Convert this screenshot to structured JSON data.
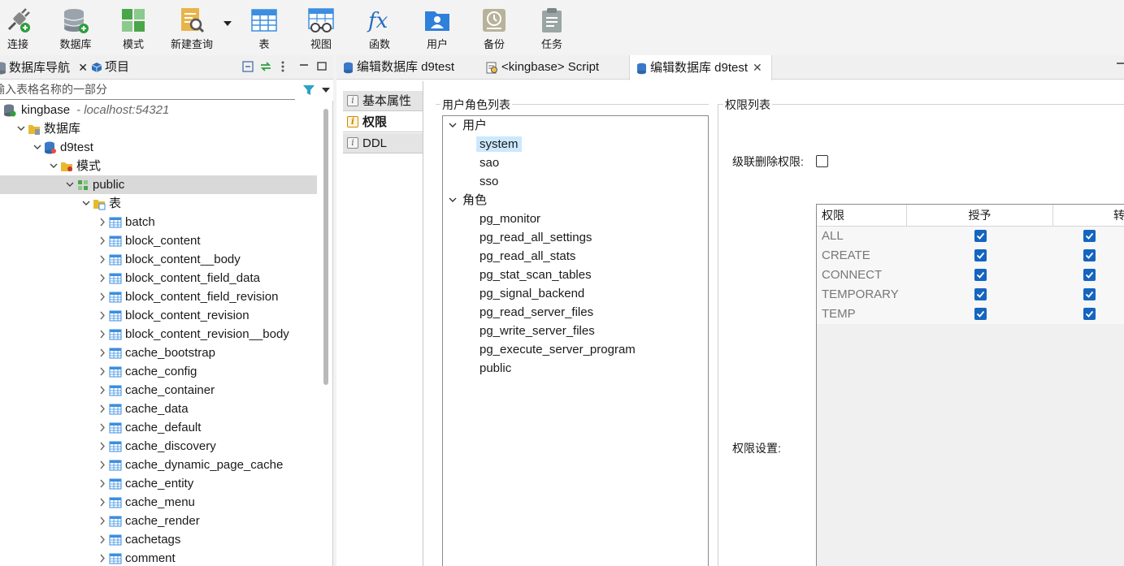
{
  "toolbar": {
    "items": [
      {
        "label": "连接",
        "icon": "connect-plug-icon"
      },
      {
        "label": "数据库",
        "icon": "database-add-icon"
      },
      {
        "label": "模式",
        "icon": "schema-grid-icon"
      },
      {
        "label": "新建查询",
        "icon": "new-query-icon"
      },
      {
        "label": "表",
        "icon": "table-icon"
      },
      {
        "label": "视图",
        "icon": "view-glasses-icon"
      },
      {
        "label": "函数",
        "icon": "function-fx-icon"
      },
      {
        "label": "用户",
        "icon": "user-icon"
      },
      {
        "label": "备份",
        "icon": "backup-clock-icon"
      },
      {
        "label": "任务",
        "icon": "task-clipboard-icon"
      }
    ]
  },
  "navigator": {
    "tab_db_nav": "数据库导航",
    "tab_project": "项目",
    "filter_placeholder": "输入表格名称的一部分",
    "connection": {
      "name": "kingbase",
      "host": "- localhost:54321"
    },
    "databases_label": "数据库",
    "database": "d9test",
    "schemas_label": "模式",
    "schema": "public",
    "tables_label": "表",
    "tables": [
      "batch",
      "block_content",
      "block_content__body",
      "block_content_field_data",
      "block_content_field_revision",
      "block_content_revision",
      "block_content_revision__body",
      "cache_bootstrap",
      "cache_config",
      "cache_container",
      "cache_data",
      "cache_default",
      "cache_discovery",
      "cache_dynamic_page_cache",
      "cache_entity",
      "cache_menu",
      "cache_render",
      "cachetags",
      "comment"
    ]
  },
  "editor": {
    "tabs": [
      {
        "label": "编辑数据库 d9test",
        "active": false
      },
      {
        "label": "<kingbase> Script",
        "active": false
      },
      {
        "label": "编辑数据库 d9test",
        "active": true,
        "closable": true
      }
    ],
    "side_tabs": [
      "基本属性",
      "权限",
      "DDL"
    ],
    "active_side_tab": "权限",
    "role_list_title": "用户角色列表",
    "users_group": "用户",
    "users": [
      "system",
      "sao",
      "sso"
    ],
    "selected_user": "system",
    "roles_group": "角色",
    "roles": [
      "pg_monitor",
      "pg_read_all_settings",
      "pg_read_all_stats",
      "pg_stat_scan_tables",
      "pg_signal_backend",
      "pg_read_server_files",
      "pg_write_server_files",
      "pg_execute_server_program",
      "public"
    ],
    "perm_list_title": "权限列表",
    "cascade_label": "级联删除权限:",
    "perm_settings_label": "权限设置:",
    "perm_table": {
      "headers": [
        "权限",
        "授予",
        "转"
      ],
      "rows": [
        {
          "name": "ALL",
          "grant": true,
          "transfer": true
        },
        {
          "name": "CREATE",
          "grant": true,
          "transfer": true
        },
        {
          "name": "CONNECT",
          "grant": true,
          "transfer": true
        },
        {
          "name": "TEMPORARY",
          "grant": true,
          "transfer": true
        },
        {
          "name": "TEMP",
          "grant": true,
          "transfer": true
        }
      ]
    }
  },
  "colors": {
    "accent": "#1565c0",
    "selection": "#cce8ff",
    "tree_selection": "#d9d9d9"
  }
}
